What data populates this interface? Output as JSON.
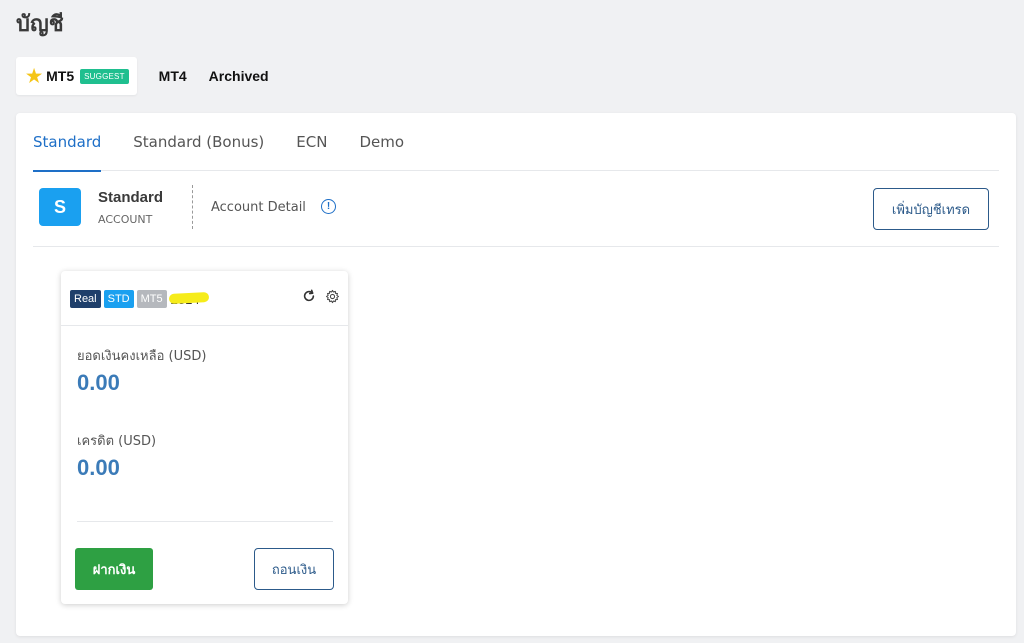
{
  "page": {
    "title": "บัญชี"
  },
  "platform_tabs": {
    "mt5": {
      "label": "MT5",
      "badge": "SUGGEST",
      "icon": "star-icon"
    },
    "mt4": {
      "label": "MT4"
    },
    "archived": {
      "label": "Archived"
    }
  },
  "account_types": [
    "Standard",
    "Standard (Bonus)",
    "ECN",
    "Demo"
  ],
  "account_header": {
    "icon_letter": "S",
    "name": "Standard",
    "sub": "ACCOUNT",
    "detail_label": "Account Detail",
    "add_button": "เพิ่มบัญชีเทรด"
  },
  "trade_card": {
    "badges": {
      "real": "Real",
      "std": "STD",
      "mt5": "MT5"
    },
    "account_number": "2814",
    "balance_label": "ยอดเงินคงเหลือ (USD)",
    "balance_value": "0.00",
    "credit_label": "เครดิต (USD)",
    "credit_value": "0.00",
    "deposit_button": "ฝากเงิน",
    "withdraw_button": "ถอนเงิน"
  },
  "colors": {
    "accent": "#1e6fc7",
    "deposit": "#2ea043",
    "suggest": "#1fbf8f",
    "value": "#3b7bb8"
  }
}
